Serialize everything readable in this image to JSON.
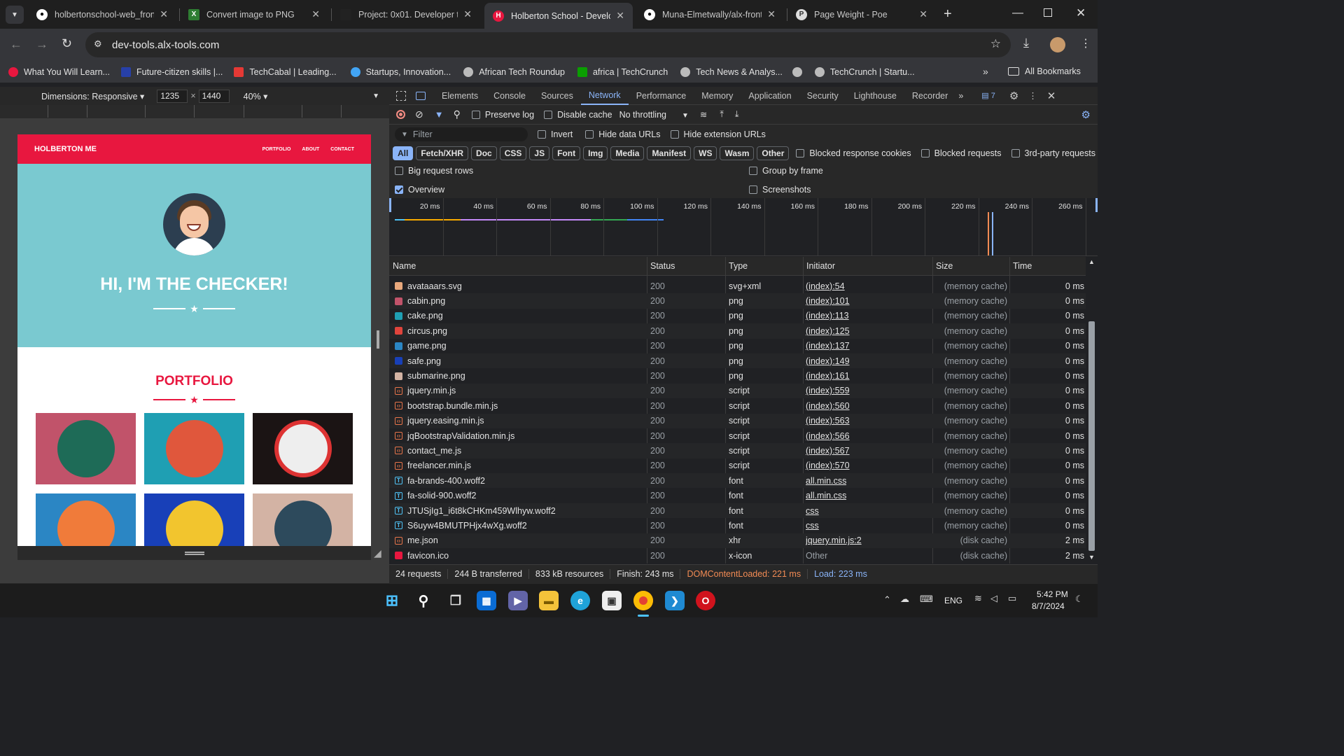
{
  "browser": {
    "tabs": [
      {
        "title": "holbertonschool-web_fron",
        "icon": "github-icon"
      },
      {
        "title": "Convert image to PNG",
        "icon": "convert-icon"
      },
      {
        "title": "Project: 0x01. Developer to",
        "icon": "alx-icon"
      },
      {
        "title": "Holberton School - Develo",
        "icon": "holberton-icon"
      },
      {
        "title": "Muna-Elmetwally/alx-front",
        "icon": "github-icon"
      },
      {
        "title": "Page Weight - Poe",
        "icon": "poe-icon"
      }
    ],
    "active_tab_index": 3,
    "url": "dev-tools.alx-tools.com",
    "bookmarks": [
      "What You Will Learn...",
      "Future-citizen skills |...",
      "TechCabal | Leading...",
      "Startups, Innovation...",
      "African Tech Roundup",
      "africa | TechCrunch",
      "Tech News & Analys...",
      "",
      "TechCrunch | Startu..."
    ],
    "all_bookmarks": "All Bookmarks"
  },
  "device_toolbar": {
    "dimensions_label": "Dimensions: Responsive",
    "width": "1235",
    "times": "×",
    "height": "1440",
    "zoom": "40%"
  },
  "site": {
    "brand": "HOLBERTON ME",
    "nav": [
      "PORTFOLIO",
      "ABOUT",
      "CONTACT"
    ],
    "hero_title": "HI, I'M THE CHECKER!",
    "portfolio_title": "PORTFOLIO",
    "tile_colors": [
      "#c1536a",
      "#1f9fb3",
      "#1b1414",
      "#2b86c4",
      "#1840b8",
      "#d3b3a4"
    ]
  },
  "devtools": {
    "tabs": [
      "Elements",
      "Console",
      "Sources",
      "Network",
      "Performance",
      "Memory",
      "Application",
      "Security",
      "Lighthouse",
      "Recorder"
    ],
    "active_tab": "Network",
    "issues_count": "7",
    "preserve_log": "Preserve log",
    "disable_cache": "Disable cache",
    "throttling": "No throttling",
    "filter_placeholder": "Filter",
    "invert": "Invert",
    "hide_data_urls": "Hide data URLs",
    "hide_extension_urls": "Hide extension URLs",
    "type_filters": [
      "All",
      "Fetch/XHR",
      "Doc",
      "CSS",
      "JS",
      "Font",
      "Img",
      "Media",
      "Manifest",
      "WS",
      "Wasm",
      "Other"
    ],
    "blocked_response_cookies": "Blocked response cookies",
    "blocked_requests": "Blocked requests",
    "third_party": "3rd-party requests",
    "big_request_rows": "Big request rows",
    "group_by_frame": "Group by frame",
    "overview": "Overview",
    "screenshots": "Screenshots",
    "timeline_ticks": [
      "20 ms",
      "40 ms",
      "60 ms",
      "80 ms",
      "100 ms",
      "120 ms",
      "140 ms",
      "160 ms",
      "180 ms",
      "200 ms",
      "220 ms",
      "240 ms",
      "260 ms"
    ],
    "columns": [
      "Name",
      "Status",
      "Type",
      "Initiator",
      "Size",
      "Time"
    ],
    "requests": [
      {
        "name": "avataaars.svg",
        "status": "200",
        "type": "svg+xml",
        "initiator": "(index):54",
        "size": "(memory cache)",
        "time": "0 ms",
        "icon": "svg-icon",
        "color": "#e8a87c"
      },
      {
        "name": "cabin.png",
        "status": "200",
        "type": "png",
        "initiator": "(index):101",
        "size": "(memory cache)",
        "time": "0 ms",
        "icon": "image-icon",
        "color": "#c1536a"
      },
      {
        "name": "cake.png",
        "status": "200",
        "type": "png",
        "initiator": "(index):113",
        "size": "(memory cache)",
        "time": "0 ms",
        "icon": "image-icon",
        "color": "#1f9fb3"
      },
      {
        "name": "circus.png",
        "status": "200",
        "type": "png",
        "initiator": "(index):125",
        "size": "(memory cache)",
        "time": "0 ms",
        "icon": "image-icon",
        "color": "#e0443c"
      },
      {
        "name": "game.png",
        "status": "200",
        "type": "png",
        "initiator": "(index):137",
        "size": "(memory cache)",
        "time": "0 ms",
        "icon": "image-icon",
        "color": "#2b86c4"
      },
      {
        "name": "safe.png",
        "status": "200",
        "type": "png",
        "initiator": "(index):149",
        "size": "(memory cache)",
        "time": "0 ms",
        "icon": "image-icon",
        "color": "#1840b8"
      },
      {
        "name": "submarine.png",
        "status": "200",
        "type": "png",
        "initiator": "(index):161",
        "size": "(memory cache)",
        "time": "0 ms",
        "icon": "image-icon",
        "color": "#d3b3a4"
      },
      {
        "name": "jquery.min.js",
        "status": "200",
        "type": "script",
        "initiator": "(index):559",
        "size": "(memory cache)",
        "time": "0 ms",
        "icon": "script-icon",
        "color": "#e8744a"
      },
      {
        "name": "bootstrap.bundle.min.js",
        "status": "200",
        "type": "script",
        "initiator": "(index):560",
        "size": "(memory cache)",
        "time": "0 ms",
        "icon": "script-icon",
        "color": "#e8744a"
      },
      {
        "name": "jquery.easing.min.js",
        "status": "200",
        "type": "script",
        "initiator": "(index):563",
        "size": "(memory cache)",
        "time": "0 ms",
        "icon": "script-icon",
        "color": "#e8744a"
      },
      {
        "name": "jqBootstrapValidation.min.js",
        "status": "200",
        "type": "script",
        "initiator": "(index):566",
        "size": "(memory cache)",
        "time": "0 ms",
        "icon": "script-icon",
        "color": "#e8744a"
      },
      {
        "name": "contact_me.js",
        "status": "200",
        "type": "script",
        "initiator": "(index):567",
        "size": "(memory cache)",
        "time": "0 ms",
        "icon": "script-icon",
        "color": "#e8744a"
      },
      {
        "name": "freelancer.min.js",
        "status": "200",
        "type": "script",
        "initiator": "(index):570",
        "size": "(memory cache)",
        "time": "0 ms",
        "icon": "script-icon",
        "color": "#e8744a"
      },
      {
        "name": "fa-brands-400.woff2",
        "status": "200",
        "type": "font",
        "initiator": "all.min.css",
        "size": "(memory cache)",
        "time": "0 ms",
        "icon": "font-icon",
        "color": "#4fc3f7"
      },
      {
        "name": "fa-solid-900.woff2",
        "status": "200",
        "type": "font",
        "initiator": "all.min.css",
        "size": "(memory cache)",
        "time": "0 ms",
        "icon": "font-icon",
        "color": "#4fc3f7"
      },
      {
        "name": "JTUSjIg1_i6t8kCHKm459Wlhyw.woff2",
        "status": "200",
        "type": "font",
        "initiator": "css",
        "size": "(memory cache)",
        "time": "0 ms",
        "icon": "font-icon",
        "color": "#4fc3f7"
      },
      {
        "name": "S6uyw4BMUTPHjx4wXg.woff2",
        "status": "200",
        "type": "font",
        "initiator": "css",
        "size": "(memory cache)",
        "time": "0 ms",
        "icon": "font-icon",
        "color": "#4fc3f7"
      },
      {
        "name": "me.json",
        "status": "200",
        "type": "xhr",
        "initiator": "jquery.min.js:2",
        "size": "(disk cache)",
        "time": "2 ms",
        "icon": "json-icon",
        "color": "#e8744a"
      },
      {
        "name": "favicon.ico",
        "status": "200",
        "type": "x-icon",
        "initiator": "Other",
        "size": "(disk cache)",
        "time": "2 ms",
        "icon": "favicon-icon",
        "color": "#e8173f"
      }
    ],
    "summary": {
      "requests": "24 requests",
      "transferred": "244 B transferred",
      "resources": "833 kB resources",
      "finish": "Finish: 243 ms",
      "dcl": "DOMContentLoaded: 221 ms",
      "load": "Load: 223 ms"
    },
    "dcl_color": "#f28b54",
    "load_color": "#8ab4f8"
  },
  "taskbar": {
    "lang": "ENG",
    "time": "5:42 PM",
    "date": "8/7/2024"
  }
}
